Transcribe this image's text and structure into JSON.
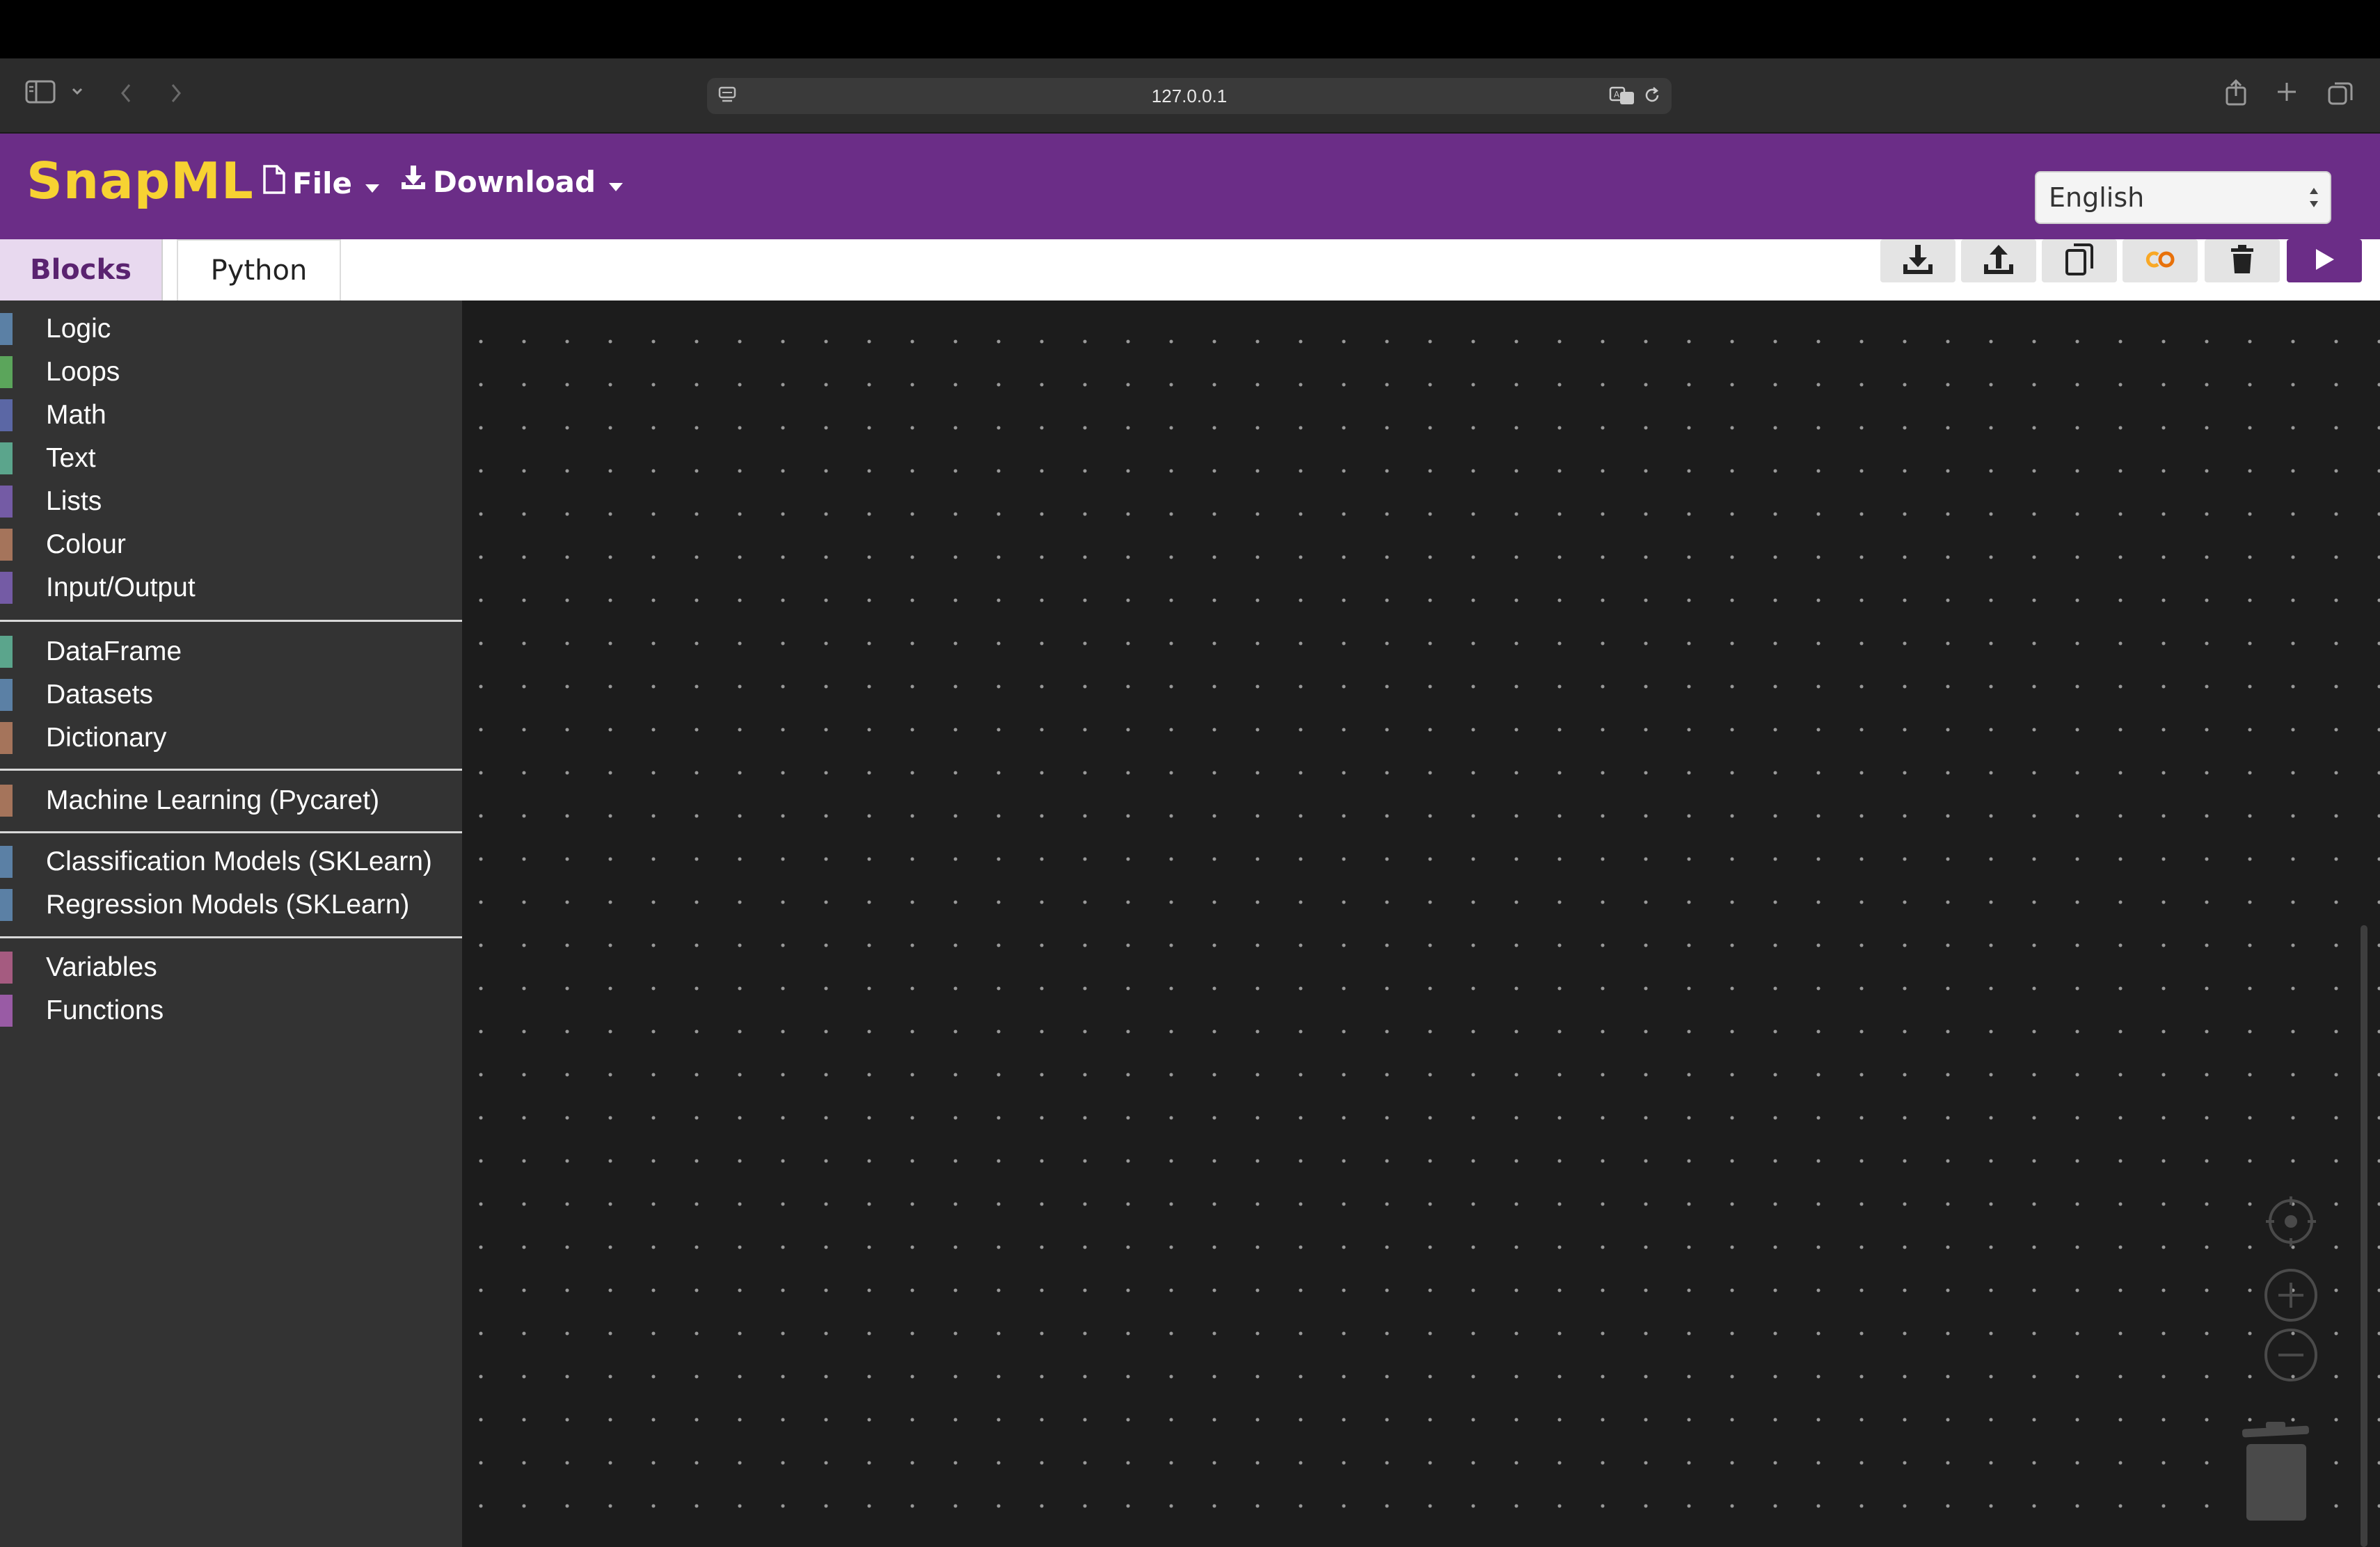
{
  "browser": {
    "url": "127.0.0.1"
  },
  "header": {
    "brand": "SnapML",
    "menus": [
      {
        "label": "File",
        "icon": "file-icon"
      },
      {
        "label": "Download",
        "icon": "download-icon"
      }
    ],
    "language": {
      "selected": "English"
    }
  },
  "tabs": [
    {
      "label": "Blocks",
      "active": true
    },
    {
      "label": "Python",
      "active": false
    }
  ],
  "toolbar": {
    "buttons": [
      "download-icon",
      "upload-icon",
      "copy-icon",
      "colab-icon",
      "trash-icon",
      "play-icon"
    ]
  },
  "sidebar": {
    "groups": [
      [
        {
          "label": "Logic",
          "color": "#5b80a5"
        },
        {
          "label": "Loops",
          "color": "#5ba55b"
        },
        {
          "label": "Math",
          "color": "#5b67a5"
        },
        {
          "label": "Text",
          "color": "#5ba58c"
        },
        {
          "label": "Lists",
          "color": "#745ba5"
        },
        {
          "label": "Colour",
          "color": "#a5745b"
        },
        {
          "label": "Input/Output",
          "color": "#745ba5"
        }
      ],
      [
        {
          "label": "DataFrame",
          "color": "#5ba58c"
        },
        {
          "label": "Datasets",
          "color": "#5b80a5"
        },
        {
          "label": "Dictionary",
          "color": "#a5745b"
        }
      ],
      [
        {
          "label": "Machine Learning (Pycaret)",
          "color": "#a5745b"
        }
      ],
      [
        {
          "label": "Classification Models (SKLearn)",
          "color": "#5b80a5"
        },
        {
          "label": "Regression Models (SKLearn)",
          "color": "#5b80a5"
        }
      ],
      [
        {
          "label": "Variables",
          "color": "#a55b80"
        },
        {
          "label": "Functions",
          "color": "#995ba5"
        }
      ]
    ]
  },
  "workspace": {
    "controls": [
      "recenter-icon",
      "zoom-in-icon",
      "zoom-out-icon",
      "workspace-trash-icon"
    ]
  },
  "colors": {
    "brand": "#f7d232",
    "header_bg": "#6b2d87",
    "sidebar_bg": "#333333",
    "workspace_bg": "#1c1c1c"
  }
}
